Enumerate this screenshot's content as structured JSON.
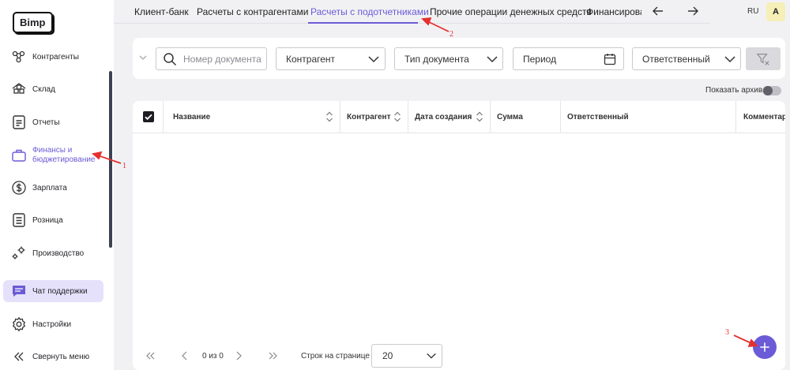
{
  "brand": {
    "logo_text": "Bimp"
  },
  "sidebar": {
    "items": [
      {
        "label": "Контрагенты",
        "icon": "contractors-icon"
      },
      {
        "label": "Склад",
        "icon": "warehouse-icon"
      },
      {
        "label": "Отчеты",
        "icon": "reports-icon"
      },
      {
        "label": "Финансы и бюджетирование",
        "icon": "finance-icon"
      },
      {
        "label": "Зарплата",
        "icon": "salary-icon"
      },
      {
        "label": "Розница",
        "icon": "retail-icon"
      },
      {
        "label": "Производство",
        "icon": "production-icon"
      },
      {
        "label": "Чат поддержки",
        "icon": "chat-icon"
      },
      {
        "label": "Настройки",
        "icon": "gear-icon"
      },
      {
        "label": "Свернуть меню",
        "icon": "collapse-icon"
      }
    ]
  },
  "tabs": {
    "items": [
      "Клиент-банк",
      "Расчеты с контрагентами",
      "Расчеты с подотчетниками",
      "Прочие операции денежных средств",
      "Финансирован"
    ],
    "active_index": 2
  },
  "header": {
    "lang": "RU",
    "avatar": "A"
  },
  "filters": {
    "doc_number_placeholder": "Номер документа",
    "contractor": "Контрагент",
    "doc_type": "Тип документа",
    "period": "Период",
    "responsible": "Ответственный"
  },
  "archive": {
    "label": "Показать архив",
    "enabled": false
  },
  "table": {
    "columns": [
      "Название",
      "Контрагент",
      "Дата создания",
      "Сумма",
      "Ответственный",
      "Комментар"
    ]
  },
  "pagination": {
    "page_info": "0 из 0",
    "rows_label": "Строк на странице",
    "rows_value": "20"
  },
  "annotations": [
    "1",
    "2",
    "3"
  ],
  "colors": {
    "accent": "#6b5bd6",
    "annotation": "#e53030",
    "support_bg": "#e6e1fb"
  }
}
